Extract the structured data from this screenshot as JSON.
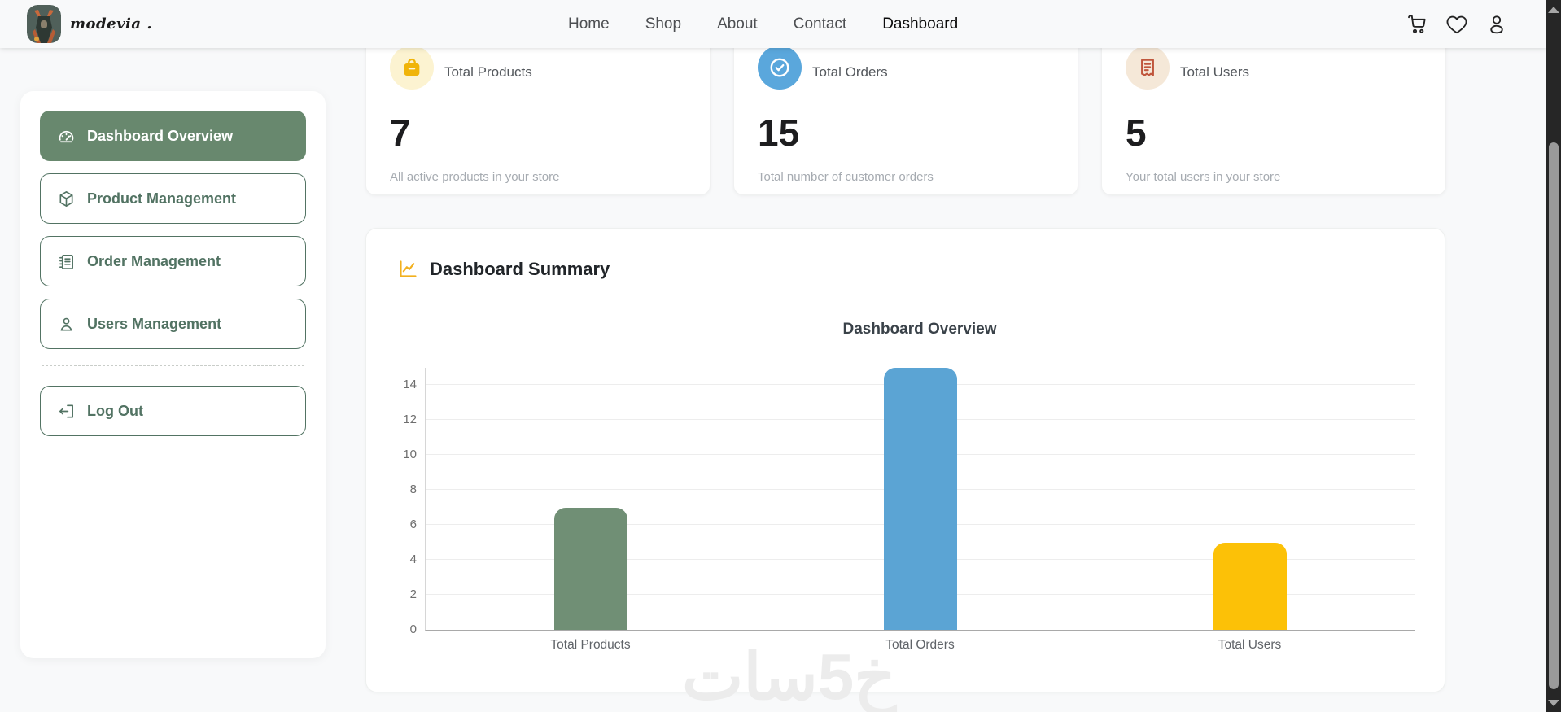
{
  "branding": {
    "logo_text": "modevia ."
  },
  "nav": {
    "items": [
      {
        "label": "Home",
        "active": false
      },
      {
        "label": "Shop",
        "active": false
      },
      {
        "label": "About",
        "active": false
      },
      {
        "label": "Contact",
        "active": false
      },
      {
        "label": "Dashboard",
        "active": true
      }
    ]
  },
  "sidebar": {
    "items": [
      {
        "label": "Dashboard Overview",
        "active": true
      },
      {
        "label": "Product Management",
        "active": false
      },
      {
        "label": "Order Management",
        "active": false
      },
      {
        "label": "Users Management",
        "active": false
      }
    ],
    "logout_label": "Log Out"
  },
  "stats": [
    {
      "title": "Total Products",
      "value": "7",
      "caption": "All active products in your store",
      "icon": "bag-icon",
      "icon_color": "#f0b40a",
      "icon_bg": "#fcf3d1"
    },
    {
      "title": "Total Orders",
      "value": "15",
      "caption": "Total number of customer orders",
      "icon": "check-circle-icon",
      "icon_color": "#ffffff",
      "icon_bg": "#5aa7dc"
    },
    {
      "title": "Total Users",
      "value": "5",
      "caption": "Your total users in your store",
      "icon": "receipt-icon",
      "icon_color": "#c0563c",
      "icon_bg": "#f5e8d8"
    }
  ],
  "summary": {
    "heading": "Dashboard Summary"
  },
  "chart_data": {
    "type": "bar",
    "title": "Dashboard Overview",
    "categories": [
      "Total Products",
      "Total Orders",
      "Total Users"
    ],
    "values": [
      7,
      15,
      5
    ],
    "colors": [
      "#708f75",
      "#5ba4d4",
      "#fcc107"
    ],
    "yticks": [
      0,
      2,
      4,
      6,
      8,
      10,
      12,
      14
    ],
    "ylim": [
      0,
      15
    ],
    "xlabel": "",
    "ylabel": "",
    "grid": true,
    "legend": false
  },
  "watermark": {
    "text": "خ5سات"
  },
  "colors": {
    "page-bg": "#f8f9fa",
    "accent-green": "#68886e",
    "sidebar-green": "#527363",
    "bar-green": "#708f75",
    "bar-blue": "#5ba4d4",
    "bar-yellow": "#fcc107"
  }
}
